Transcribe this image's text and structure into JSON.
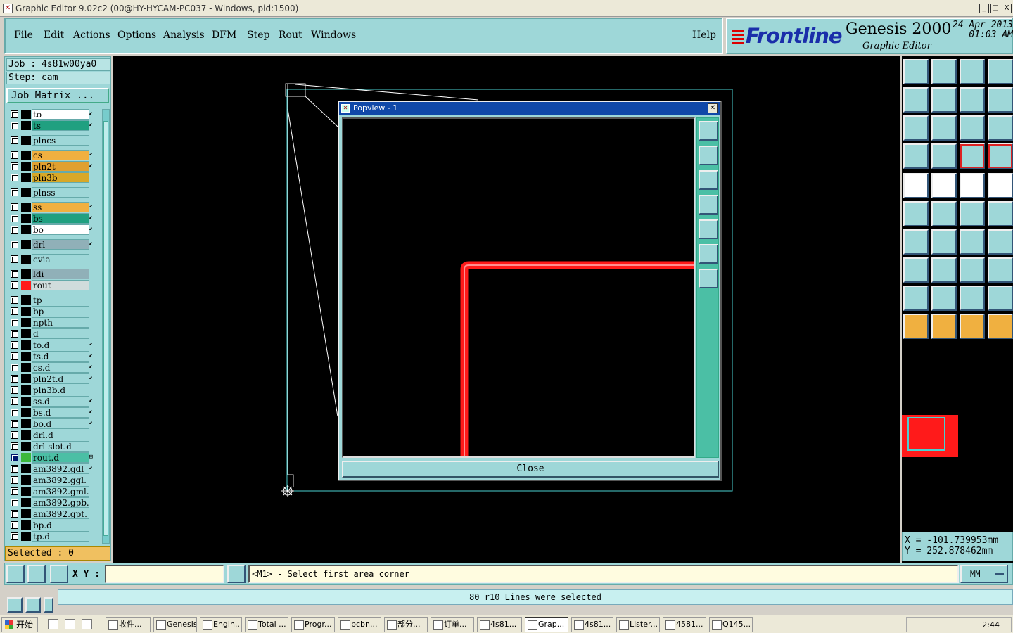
{
  "window": {
    "title": "Graphic Editor 9.02c2 (00@HY-HYCAM-PC037 - Windows, pid:1500)",
    "min": "_",
    "max": "□",
    "close": "X"
  },
  "menu": {
    "file": "File",
    "edit": "Edit",
    "actions": "Actions",
    "options": "Options",
    "analysis": "Analysis",
    "dfm": "DFM",
    "step": "Step",
    "rout": "Rout",
    "windows": "Windows",
    "help": "Help"
  },
  "brand": {
    "logo": "Frontline",
    "product": "Genesis 2000",
    "subtitle": "Graphic Editor",
    "date": "24 Apr 2013",
    "time": "01:03 AM"
  },
  "job": {
    "job_label": "Job : 4s81w00ya0",
    "step_label": "Step: cam",
    "matrix_button": "Job Matrix ..."
  },
  "layers": [
    {
      "name": "to",
      "color": "#ffffff",
      "mark": "⬋"
    },
    {
      "name": "ts",
      "color": "#20a080",
      "mark": "⬋"
    },
    {
      "name": "plncs",
      "color": "#9ed7d8",
      "mark": ""
    },
    {
      "name": "cs",
      "color": "#f0b040",
      "mark": "⬋"
    },
    {
      "name": "pln2t",
      "color": "#e0a030",
      "mark": "⬋"
    },
    {
      "name": "pln3b",
      "color": "#d8a828",
      "mark": ""
    },
    {
      "name": "plnss",
      "color": "#9ed7d8",
      "mark": ""
    },
    {
      "name": "ss",
      "color": "#f0b040",
      "mark": "⬋"
    },
    {
      "name": "bs",
      "color": "#20a080",
      "mark": "⬋"
    },
    {
      "name": "bo",
      "color": "#ffffff",
      "mark": "⬋"
    },
    {
      "name": "drl",
      "color": "#90b0b8",
      "mark": "⬋"
    },
    {
      "name": "cvia",
      "color": "#9ed7d8",
      "mark": ""
    },
    {
      "name": "ldi",
      "color": "#90b0b8",
      "mark": ""
    },
    {
      "name": "rout",
      "color": "#d0dcdc",
      "mark": ""
    },
    {
      "name": "tp",
      "color": "#9ed7d8",
      "mark": ""
    },
    {
      "name": "bp",
      "color": "#9ed7d8",
      "mark": ""
    },
    {
      "name": "npth",
      "color": "#9ed7d8",
      "mark": ""
    },
    {
      "name": "d",
      "color": "#9ed7d8",
      "mark": ""
    },
    {
      "name": "to.d",
      "color": "#9ed7d8",
      "mark": "⬋"
    },
    {
      "name": "ts.d",
      "color": "#9ed7d8",
      "mark": "⬋"
    },
    {
      "name": "cs.d",
      "color": "#9ed7d8",
      "mark": "⬋"
    },
    {
      "name": "pln2t.d",
      "color": "#9ed7d8",
      "mark": "⬋"
    },
    {
      "name": "pln3b.d",
      "color": "#9ed7d8",
      "mark": ""
    },
    {
      "name": "ss.d",
      "color": "#9ed7d8",
      "mark": "⬋"
    },
    {
      "name": "bs.d",
      "color": "#9ed7d8",
      "mark": "⬋"
    },
    {
      "name": "bo.d",
      "color": "#9ed7d8",
      "mark": "⬋"
    },
    {
      "name": "drl.d",
      "color": "#9ed7d8",
      "mark": ""
    },
    {
      "name": "drl-slot.d",
      "color": "#9ed7d8",
      "mark": ""
    },
    {
      "name": "rout.d",
      "color": "#4bbfa5",
      "mark": "⊞"
    },
    {
      "name": "am3892.gdl",
      "color": "#9ed7d8",
      "mark": "⬋"
    },
    {
      "name": "am3892.ggl.",
      "color": "#9ed7d8",
      "mark": ""
    },
    {
      "name": "am3892.gml.",
      "color": "#9ed7d8",
      "mark": ""
    },
    {
      "name": "am3892.gpb.",
      "color": "#9ed7d8",
      "mark": ""
    },
    {
      "name": "am3892.gpt.",
      "color": "#9ed7d8",
      "mark": ""
    },
    {
      "name": "bp.d",
      "color": "#9ed7d8",
      "mark": ""
    },
    {
      "name": "tp.d",
      "color": "#9ed7d8",
      "mark": ""
    }
  ],
  "selected": "Selected : 0",
  "popview": {
    "title": "Popview - 1",
    "close_label": "Close"
  },
  "coords": {
    "x": "X = -101.739953mm",
    "y": "Y = 252.878462mm"
  },
  "command": {
    "xy_label": "X Y :",
    "xy_value": "",
    "prompt": "<M1> - Select first area corner",
    "units": "MM"
  },
  "status": "80 r10 Lines were selected",
  "taskbar": {
    "start": "开始",
    "tasks": [
      "收件...",
      "Genesis",
      "Engin...",
      "Total ...",
      "Progr...",
      "pcbn...",
      "部分...",
      "订单...",
      "4s81...",
      "Grap...",
      "4s81...",
      "Lister...",
      "4581...",
      "Q145..."
    ],
    "clock": "2:44"
  },
  "colors": {
    "panel": "#9ed7d8",
    "accent_red": "#ff1a1a",
    "outline": "#4ad0d0"
  }
}
